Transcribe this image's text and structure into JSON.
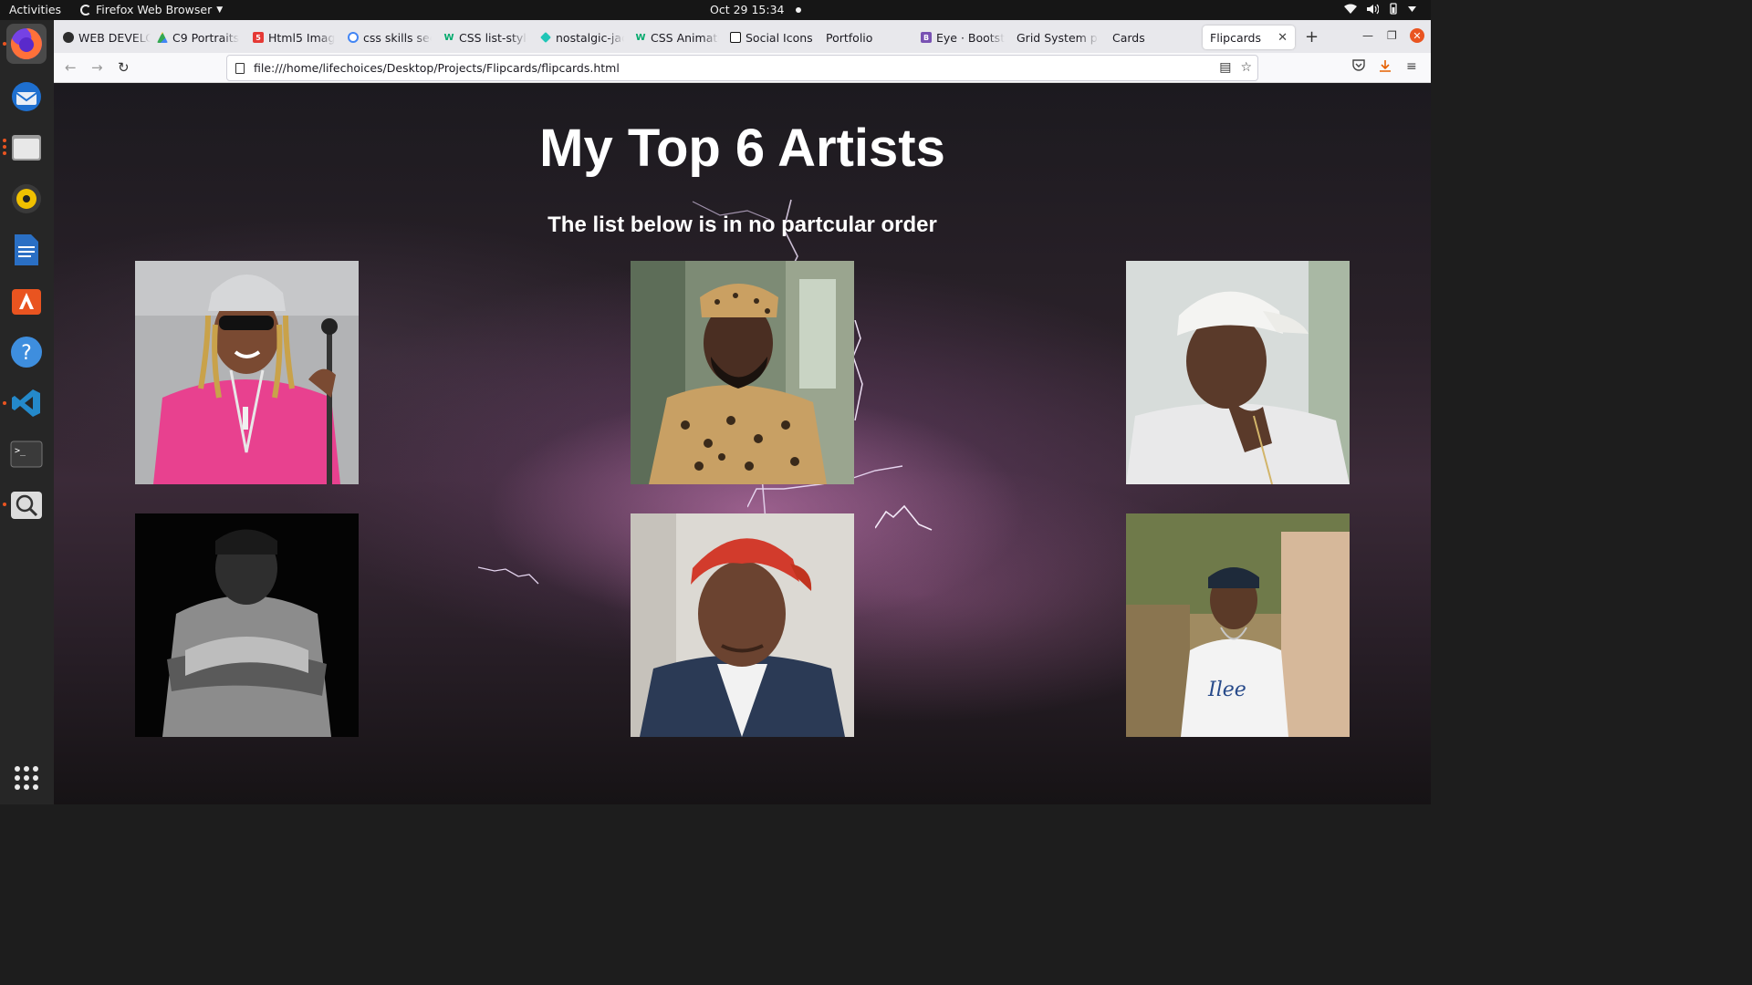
{
  "topbar": {
    "activities": "Activities",
    "app_name": "Firefox Web Browser",
    "datetime": "Oct 29  15:34"
  },
  "dock": {
    "items": [
      {
        "name": "firefox-icon",
        "running": true,
        "active": true
      },
      {
        "name": "thunderbird-icon",
        "running": false
      },
      {
        "name": "files-icon",
        "running": true
      },
      {
        "name": "rhythmbox-icon",
        "running": false
      },
      {
        "name": "libreoffice-writer-icon",
        "running": false
      },
      {
        "name": "software-center-icon",
        "running": false
      },
      {
        "name": "help-icon",
        "running": false
      },
      {
        "name": "vscode-icon",
        "running": true
      },
      {
        "name": "terminal-icon",
        "running": false
      },
      {
        "name": "magnifier-icon",
        "running": true
      }
    ]
  },
  "browser": {
    "tabs": [
      {
        "label": "WEB DEVELO",
        "icon": "web-dev-icon",
        "color": "#2d2d2d"
      },
      {
        "label": "C9 Portraits",
        "icon": "google-drive-icon",
        "color": "#fbbc04"
      },
      {
        "label": "Html5 Image",
        "icon": "html5-icon",
        "color": "#e53935"
      },
      {
        "label": "css skills sec",
        "icon": "google-icon",
        "color": "#4285f4"
      },
      {
        "label": "CSS list-style",
        "icon": "w3schools-icon",
        "color": "#04aa6d"
      },
      {
        "label": "nostalgic-jac",
        "icon": "netlify-icon",
        "color": "#20c6b7"
      },
      {
        "label": "CSS Animatio",
        "icon": "w3schools-icon",
        "color": "#04aa6d"
      },
      {
        "label": "Social Icons",
        "icon": "codepen-icon",
        "color": "#111111"
      },
      {
        "label": "Portfolio",
        "icon": "",
        "color": ""
      },
      {
        "label": "Eye · Bootstr",
        "icon": "bootstrap-icon",
        "color": "#7952b3"
      },
      {
        "label": "Grid System par",
        "icon": "",
        "color": ""
      },
      {
        "label": "Cards",
        "icon": "",
        "color": ""
      }
    ],
    "selected_tab": "Flipcards",
    "url": "file:///home/lifechoices/Desktop/Projects/Flipcards/flipcards.html"
  },
  "page": {
    "title": "My Top 6 Artists",
    "subtitle": "The list below is in no partcular order",
    "artists": [
      {
        "name": "artist-card-1",
        "bg": "#b0b0b0",
        "shirt": "#e8418f",
        "skin": "#7a4a32"
      },
      {
        "name": "artist-card-2",
        "bg": "#6f7f6a",
        "shirt": "#c8a064",
        "skin": "#4a2e22"
      },
      {
        "name": "artist-card-3",
        "bg": "#cfd6d4",
        "shirt": "#eeeeee",
        "skin": "#5a3a2a"
      },
      {
        "name": "artist-card-4",
        "bg": "#050505",
        "shirt": "#9a9a9a",
        "skin": "#2c2c2c"
      },
      {
        "name": "artist-card-5",
        "bg": "#d9d6d0",
        "shirt": "#2b3a55",
        "skin": "#6b4330"
      },
      {
        "name": "artist-card-6",
        "bg": "#a99468",
        "shirt": "#f2f2f2",
        "skin": "#5b3a28"
      }
    ]
  }
}
